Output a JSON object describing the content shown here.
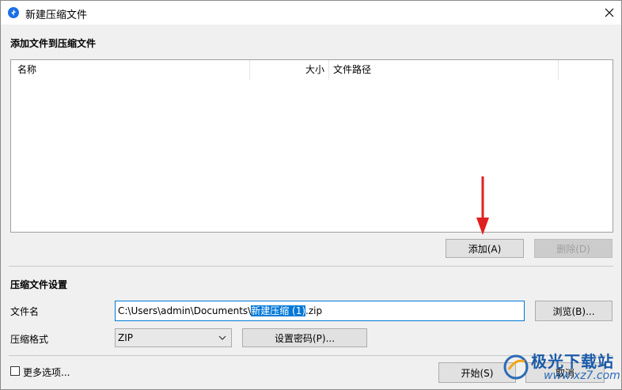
{
  "window": {
    "title": "新建压缩文件",
    "accent_color": "#0078d7"
  },
  "add_files": {
    "section_title": "添加文件到压缩文件",
    "columns": [
      "名称",
      "大小",
      "文件路径"
    ],
    "add_button": "添加(A)",
    "delete_button": "删除(D)"
  },
  "settings": {
    "section_title": "压缩文件设置",
    "filename_label": "文件名",
    "path_prefix": "C:\\Users\\admin\\Documents\\",
    "path_selected": "新建压缩 (1)",
    "path_suffix": ".zip",
    "browse_button": "浏览(B)...",
    "format_label": "压缩格式",
    "format_value": "ZIP",
    "password_button": "设置密码(P)..."
  },
  "footer": {
    "more_options_label": "更多选项...",
    "more_options_checked": false,
    "start_button": "开始(S)",
    "cancel_button": "取消"
  },
  "watermark": {
    "text": "极光下载站",
    "domain": "www.xz7.com"
  }
}
